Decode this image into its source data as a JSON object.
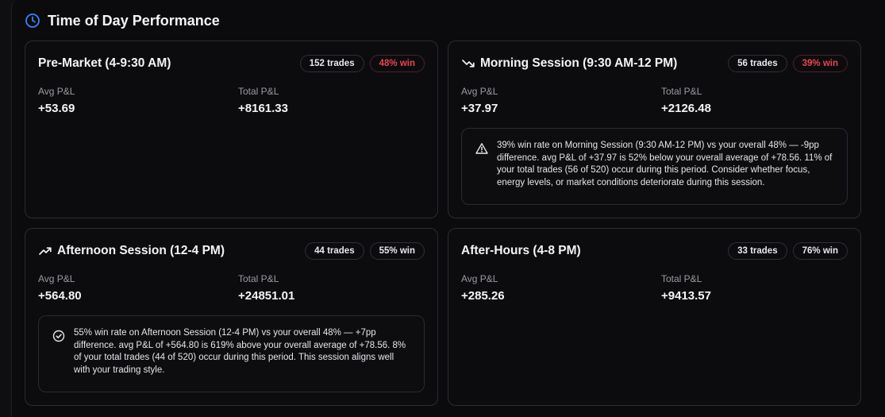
{
  "panel": {
    "title": "Time of Day Performance"
  },
  "labels": {
    "avg": "Avg P&L",
    "total": "Total P&L"
  },
  "sessions": [
    {
      "title": "Pre-Market (4-9:30 AM)",
      "trades": "152 trades",
      "win": "48% win",
      "win_status": "negative",
      "avg": "+53.69",
      "total": "+8161.33",
      "trend_icon": "none",
      "insight": ""
    },
    {
      "title": "Morning Session (9:30 AM-12 PM)",
      "trades": "56 trades",
      "win": "39% win",
      "win_status": "negative",
      "avg": "+37.97",
      "total": "+2126.48",
      "trend_icon": "trending-down-icon",
      "insight_icon": "warning-icon",
      "insight": "39% win rate on Morning Session (9:30 AM-12 PM) vs your overall 48% — -9pp difference. avg P&L of +37.97 is 52% below your overall average of +78.56. 11% of your total trades (56 of 520) occur during this period. Consider whether focus, energy levels, or market conditions deteriorate during this session."
    },
    {
      "title": "Afternoon Session (12-4 PM)",
      "trades": "44 trades",
      "win": "55% win",
      "win_status": "positive",
      "avg": "+564.80",
      "total": "+24851.01",
      "trend_icon": "trending-up-icon",
      "insight_icon": "check-circle-icon",
      "insight": "55% win rate on Afternoon Session (12-4 PM) vs your overall 48% — +7pp difference. avg P&L of +564.80 is 619% above your overall average of +78.56. 8% of your total trades (44 of 520) occur during this period. This session aligns well with your trading style."
    },
    {
      "title": "After-Hours (4-8 PM)",
      "trades": "33 trades",
      "win": "76% win",
      "win_status": "positive",
      "avg": "+285.26",
      "total": "+9413.57",
      "trend_icon": "none",
      "insight": ""
    }
  ],
  "colors": {
    "accent": "#3b82f6",
    "negative": "#e5484d",
    "background": "#0b0b0e",
    "border": "#2a2a31"
  }
}
